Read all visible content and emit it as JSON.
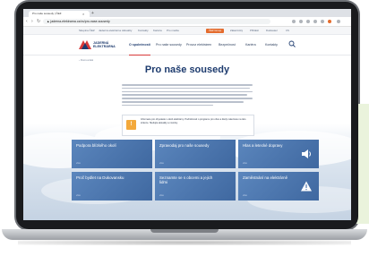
{
  "browser": {
    "tab_title": "Pro naše sousedy | ČEZ",
    "tab_close": "×",
    "new_tab": "+",
    "url": "▲ jaderna-elektrarna.cz/cs/pro-nase-sousedy",
    "nav_back": "‹",
    "nav_forward": "›",
    "nav_reload": "↻"
  },
  "topstrip": {
    "links": [
      "Skupina ČEZ",
      "Jaderná elektrárna",
      "Aktuality",
      "Kontakty",
      "Kariéra",
      "Pro média"
    ],
    "buttons": [
      {
        "label": "ČEZ Group",
        "bg": "#e46c2e",
        "color": "#ffffff"
      },
      {
        "label": "Zákaznický",
        "bg": "#f5f6f8",
        "color": "#5d6b82"
      },
      {
        "label": "Přihlásit",
        "bg": "#f5f6f8",
        "color": "#5d6b82"
      },
      {
        "label": "Dodavatel",
        "bg": "#f5f6f8",
        "color": "#5d6b82"
      },
      {
        "label": "CS",
        "bg": "#f5f6f8",
        "color": "#5d6b82"
      }
    ]
  },
  "header": {
    "logo_line1": "JADERNÁ",
    "logo_line2": "ELEKTRÁRNA",
    "nav": [
      "O společnosti",
      "Pro naše sousedy",
      "Provoz elektráren",
      "Bezpečnost",
      "Kariéra",
      "Kontakty"
    ],
    "active_index": 0
  },
  "breadcrumb": "‹ Domovská",
  "page_title": "Pro naše sousedy",
  "notice": {
    "icon": "!",
    "text": "Informace pro obyvatele v okolí elektrárny. Podrobnosti o programu pro obce a školy naleznete na této stránce. Sledujte aktuality a novinky."
  },
  "cards": [
    {
      "label": "Podpora blízkého okolí",
      "sub": "více"
    },
    {
      "label": "Zpravodaj pro naše sousedy",
      "sub": "více"
    },
    {
      "label": "Hlas a letecké dopravy",
      "sub": "více",
      "icon": "speaker-icon"
    },
    {
      "label": "Proč bydlet na Dukovansku",
      "sub": "více"
    },
    {
      "label": "Seznamte se s obcemi a jejich lidmi",
      "sub": "více"
    },
    {
      "label": "Zaměstnání na elektrárně",
      "sub": "více",
      "icon": "warning-icon"
    }
  ],
  "colors": {
    "brand_blue": "#1d3b6e",
    "card_blue": "#4f79b0",
    "accent_red": "#d83a3a",
    "notice_orange": "#f3a93c",
    "background_green": "#eaf3dc"
  }
}
